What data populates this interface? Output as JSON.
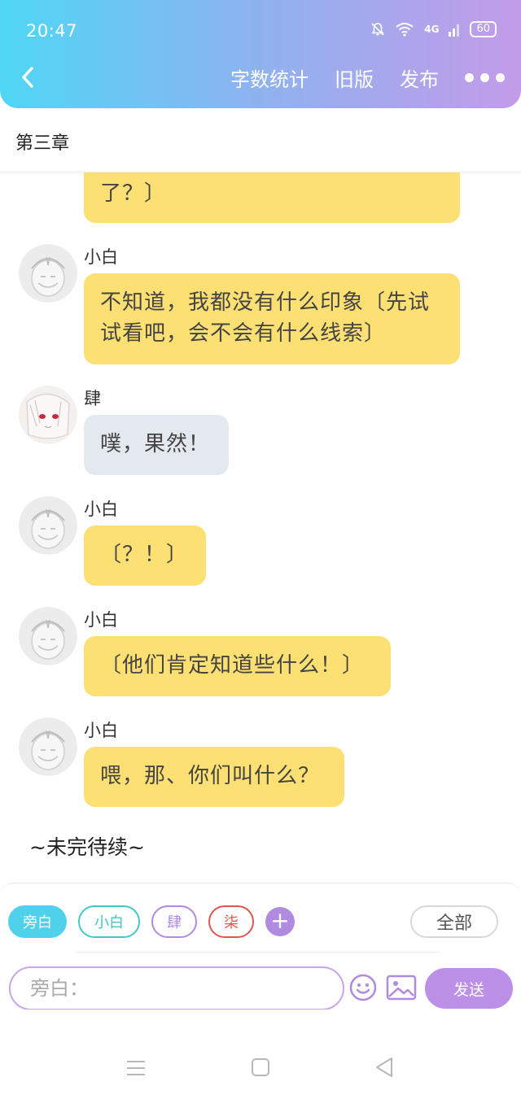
{
  "status_bar": {
    "time": "20:47",
    "network": "4G",
    "battery": "60"
  },
  "toolbar": {
    "word_count": "字数统计",
    "old_version": "旧版",
    "publish": "发布"
  },
  "chapter": {
    "title": "第三章"
  },
  "messages": [
    {
      "sender": "",
      "text": "了？〕",
      "bubble": "yellow"
    },
    {
      "sender": "小白",
      "text": "不知道，我都没有什么印象〔先试试看吧，会不会有什么线索〕",
      "bubble": "yellow"
    },
    {
      "sender": "肆",
      "text": "噗，果然！",
      "bubble": "gray"
    },
    {
      "sender": "小白",
      "text": "〔？！〕",
      "bubble": "yellow"
    },
    {
      "sender": "小白",
      "text": "〔他们肯定知道些什么！〕",
      "bubble": "yellow"
    },
    {
      "sender": "小白",
      "text": "喂，那、你们叫什么？",
      "bubble": "yellow"
    }
  ],
  "to_be_continued": "~未完待续~",
  "composer": {
    "roles": [
      "旁白",
      "小白",
      "肆",
      "柒"
    ],
    "all_label": "全部",
    "input_placeholder": "旁白：",
    "send_label": "发送"
  },
  "colors": {
    "header_start": "#4fd6f5",
    "header_end": "#c39be9",
    "bubble_yellow": "#fde074",
    "bubble_gray": "#e4e9ef",
    "accent_purple": "#bb90e6",
    "accent_cyan": "#4fd0eb"
  }
}
